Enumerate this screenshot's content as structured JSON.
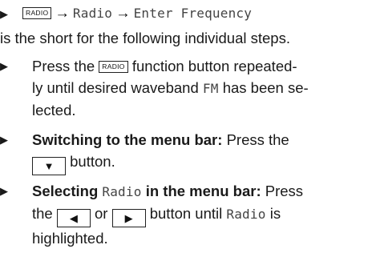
{
  "header": {
    "bullet": "▶",
    "key_radio": "RADIO",
    "arrow": "→",
    "step1": "Radio",
    "step2": "Enter Frequency"
  },
  "intro": "is the short for the following individual steps.",
  "items": [
    {
      "bullet": "▶",
      "pre": "Press the",
      "key": "RADIO",
      "post_line1": "function button repeated-",
      "line2_pre": "ly until desired waveband",
      "band": "FM",
      "line2_post": "has been se-",
      "line3": "lected."
    },
    {
      "bullet": "▶",
      "bold": "Switching to the menu bar:",
      "text": "Press the",
      "button_icon": "▼",
      "text2": "button."
    },
    {
      "bullet": "▶",
      "bold1": "Selecting",
      "mono": "Radio",
      "bold2": "in the menu bar:",
      "text": "Press",
      "text_the": "the",
      "icon_left": "◀",
      "or": "or",
      "icon_right": "▶",
      "text2": "button until",
      "mono2": "Radio",
      "text3": "is",
      "line3": "highlighted."
    }
  ]
}
